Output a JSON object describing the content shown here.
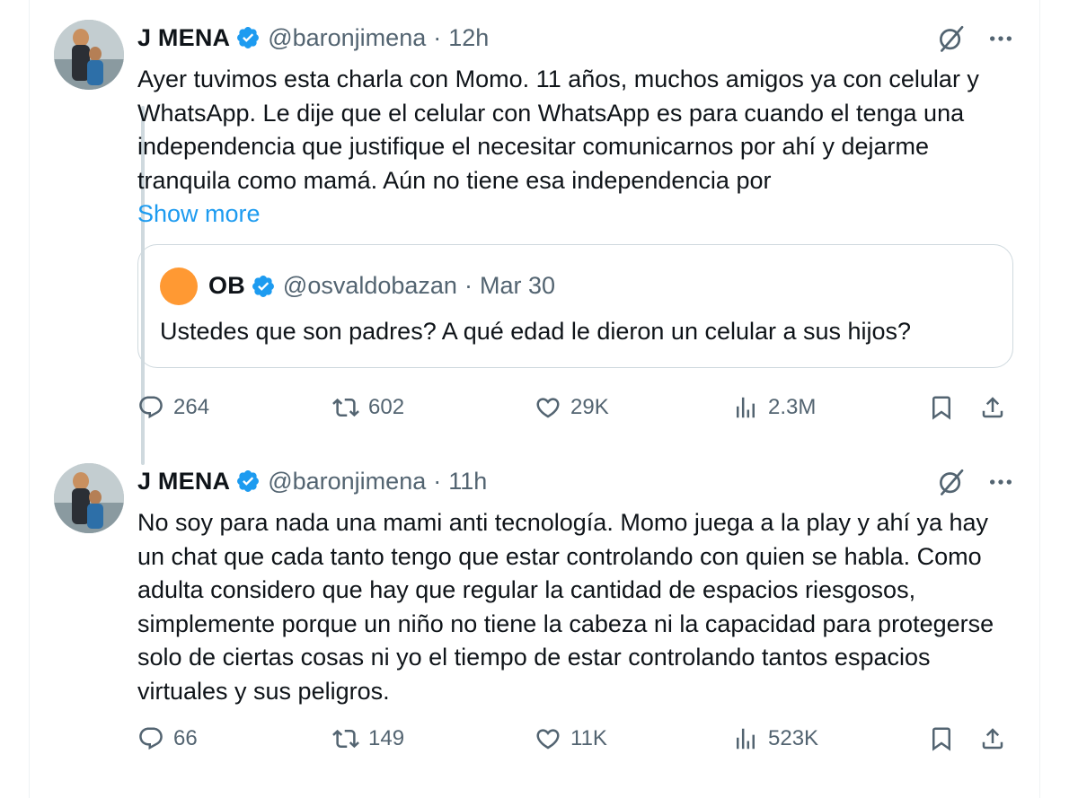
{
  "tweets": [
    {
      "author_name": "J MENA",
      "handle": "@baronjimena",
      "separator": "·",
      "time": "12h",
      "text": "Ayer tuvimos esta charla con Momo. 11 años, muchos amigos ya con celular y WhatsApp. Le dije que el celular con WhatsApp es para cuando el tenga una independencia que justifique el necesitar comunicarnos por ahí y dejarme tranquila como mamá. Aún no tiene esa independencia por",
      "show_more": "Show more",
      "quote": {
        "author_name": "OB",
        "handle": "@osvaldobazan",
        "separator": "·",
        "time": "Mar 30",
        "text": "Ustedes que son padres? A qué edad le dieron un celular a sus hijos?"
      },
      "stats": {
        "replies": "264",
        "retweets": "602",
        "likes": "29K",
        "views": "2.3M"
      }
    },
    {
      "author_name": "J MENA",
      "handle": "@baronjimena",
      "separator": "·",
      "time": "11h",
      "text": "No soy para nada una mami anti tecnología. Momo juega a la play y ahí ya hay un chat que cada tanto tengo que estar controlando con quien se habla. Como adulta considero que hay que regular la cantidad de espacios riesgosos, simplemente porque un niño no tiene la cabeza ni la capacidad para protegerse solo de ciertas cosas ni yo el tiempo de estar controlando tantos espacios virtuales y sus peligros.",
      "stats": {
        "replies": "66",
        "retweets": "149",
        "likes": "11K",
        "views": "523K"
      }
    }
  ],
  "icons": {
    "verified": "verified-badge-icon",
    "grok": "grok-icon",
    "more": "more-icon",
    "reply": "reply-icon",
    "retweet": "retweet-icon",
    "like": "heart-icon",
    "views": "views-icon",
    "bookmark": "bookmark-icon",
    "share": "share-icon"
  },
  "colors": {
    "accent": "#1d9bf0",
    "secondary_text": "#536471",
    "border": "#cfd9de",
    "quote_avatar": "#ff9933"
  }
}
